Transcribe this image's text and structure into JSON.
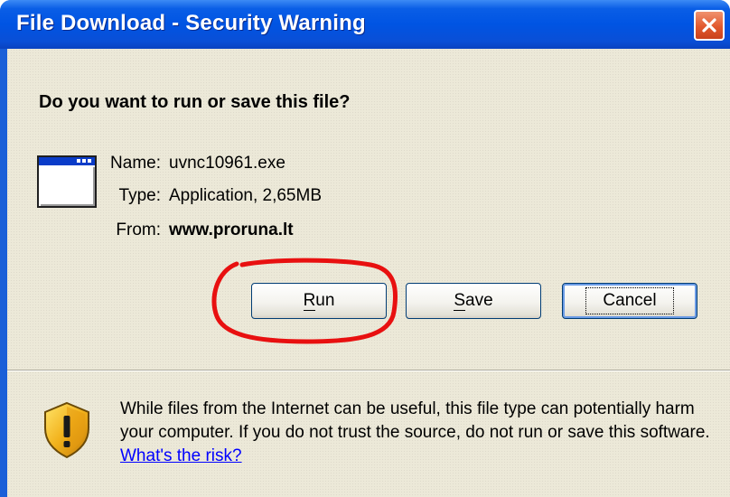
{
  "dialog": {
    "title": "File Download - Security Warning",
    "question": "Do you want to run or save this file?",
    "file": {
      "name_label": "Name:",
      "name_value": "uvnc10961.exe",
      "type_label": "Type:",
      "type_value": "Application, 2,65MB",
      "from_label": "From:",
      "from_value": "www.proruna.lt"
    },
    "buttons": {
      "run_underlined": "R",
      "run_rest": "un",
      "save_underlined": "S",
      "save_rest": "ave",
      "cancel": "Cancel"
    },
    "warning": {
      "text": "While files from the Internet can be useful, this file type can potentially harm your computer. If you do not trust the source, do not run or save this software.",
      "link": "What's the risk?"
    },
    "icons": {
      "file": "application-window-icon",
      "shield": "security-shield-icon",
      "close": "close-icon"
    },
    "colors": {
      "titlebar": "#0054e3",
      "dialog_bg": "#ece9d8",
      "close_button": "#e2592e",
      "link": "#0000ff",
      "annotation": "#e81010"
    }
  }
}
